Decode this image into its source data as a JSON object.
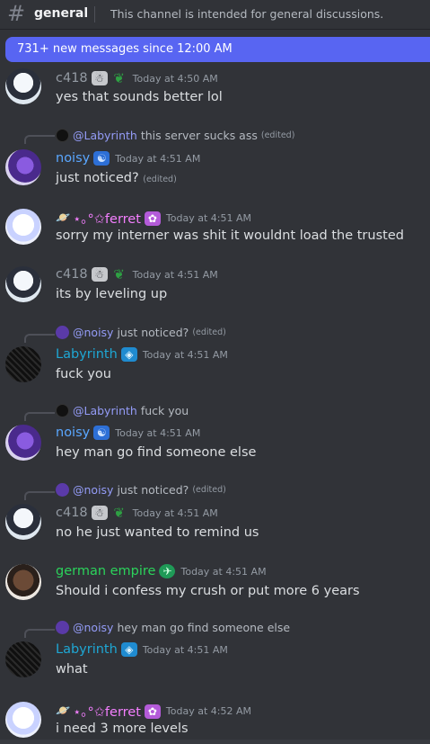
{
  "channel": {
    "name": "general",
    "topic": "This channel is intended for general discussions."
  },
  "banner": {
    "text": "731+ new messages since 12:00 AM"
  },
  "messages": [
    {
      "user": "c418",
      "badge1": "☃",
      "badge2": "❦",
      "time": "Today at 4:50 AM",
      "text": "yes that sounds better lol"
    },
    {
      "reply_mention": "@Labyrinth",
      "reply_text": "this server sucks ass",
      "reply_edited": "(edited)",
      "user": "noisy",
      "badge1": "☯",
      "time": "Today at 4:51 AM",
      "text": "just noticed?",
      "edited": "(edited)"
    },
    {
      "prefix": "🪐",
      "user": "⋆｡°✩ferret",
      "badge1": "✿",
      "time": "Today at 4:51 AM",
      "text": "sorry my interner was shit it wouldnt load the trusted"
    },
    {
      "user": "c418",
      "badge1": "☃",
      "badge2": "❦",
      "time": "Today at 4:51 AM",
      "text": "its by leveling up"
    },
    {
      "reply_mention": "@noisy",
      "reply_text": "just noticed?",
      "reply_edited": "(edited)",
      "user": "Labyrinth",
      "badge1": "◈",
      "time": "Today at 4:51 AM",
      "text": "fuck you"
    },
    {
      "reply_mention": "@Labyrinth",
      "reply_text": "fuck you",
      "user": "noisy",
      "badge1": "☯",
      "time": "Today at 4:51 AM",
      "text": "hey man go find someone else"
    },
    {
      "reply_mention": "@noisy",
      "reply_text": "just noticed?",
      "reply_edited": "(edited)",
      "user": "c418",
      "badge1": "☃",
      "badge2": "❦",
      "time": "Today at 4:51 AM",
      "text": "no he just wanted to remind us"
    },
    {
      "user": "german empire",
      "badge1": "✈",
      "time": "Today at 4:51 AM",
      "text": "Should i confess my crush or put more 6 years"
    },
    {
      "reply_mention": "@noisy",
      "reply_text": "hey man go find someone else",
      "user": "Labyrinth",
      "badge1": "◈",
      "time": "Today at 4:51 AM",
      "text": "what"
    },
    {
      "prefix": "🪐",
      "user": "⋆｡°✩ferret",
      "badge1": "✿",
      "time": "Today at 4:52 AM",
      "text": "i need 3 more levels"
    }
  ],
  "colors": {
    "background": "#313338",
    "accent": "#5865f2",
    "noisy": "#5aa7ff",
    "ferret": "#f47fff",
    "labyrinth": "#1ea7d4",
    "german_empire": "#2bd35b",
    "mention": "#949cf7"
  },
  "icons": {
    "channel": "hash-icon",
    "reply": "reply-connector-icon"
  }
}
